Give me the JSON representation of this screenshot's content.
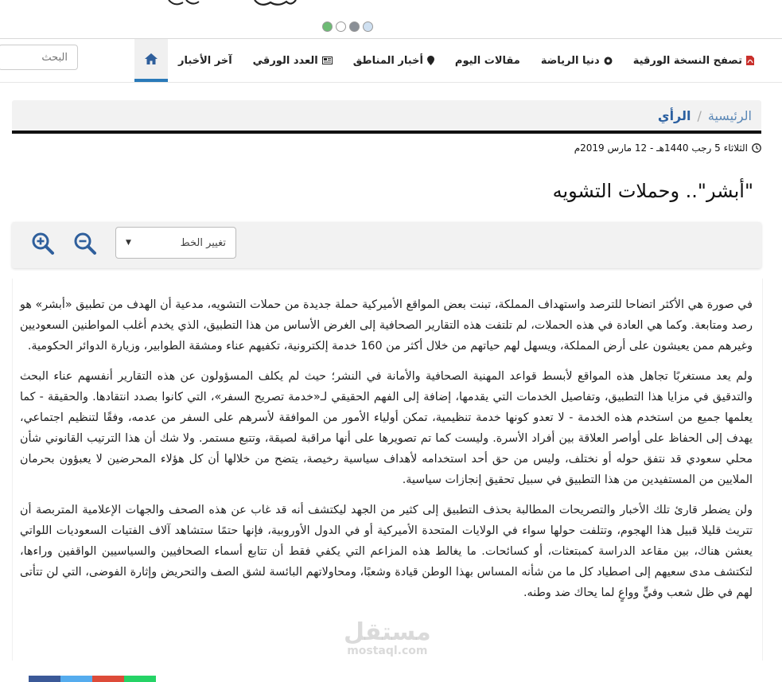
{
  "header": {
    "dots": [
      "#6dbb74",
      "#ffffff",
      "#8a8f96",
      "#cfe0f1"
    ]
  },
  "search": {
    "placeholder": "البحث"
  },
  "nav": {
    "items": [
      {
        "label": "",
        "icon": "home-icon"
      },
      {
        "label": "آخر الأخبار",
        "icon": ""
      },
      {
        "label": "العدد الورقي",
        "icon": "newspaper-icon"
      },
      {
        "label": "أخبار المناطق",
        "icon": "map-marker-icon"
      },
      {
        "label": "مقالات اليوم",
        "icon": ""
      },
      {
        "label": "دنيا الرياضة",
        "icon": "soccer-ball-icon"
      },
      {
        "label": "تصفح النسخة الورقية",
        "icon": "pdf-icon"
      }
    ]
  },
  "breadcrumb": {
    "home": "الرئيسية",
    "separator": "/",
    "current": "الرأي"
  },
  "article": {
    "date": "الثلاثاء 5 رجب 1440هـ - 12 مارس 2019م",
    "title": "\"أبشر\".. وحملات التشويه",
    "paragraphs": [
      "في صورة هي الأكثر اتضاحا للترصد واستهداف المملكة، تبنت بعض المواقع الأميركية حملة جديدة من حملات التشويه، مدعية أن الهدف من تطبيق «أبشر» هو رصد ومتابعة. وكما هي العادة في هذه الحملات، لم تلتفت هذه التقارير الصحافية إلى الغرض الأساس من هذا التطبيق، الذي يخدم أغلب المواطنين السعوديين وغيرهم ممن يعيشون على أرض المملكة، ويسهل لهم حياتهم من خلال أكثر من 160 خدمة إلكترونية، تكفيهم عناء ومشقة الطوابير، وزيارة الدوائر الحكومية.",
      "ولم يعد مستغربًا تجاهل هذه المواقع لأبسط قواعد المهنية الصحافية والأمانة في النشر؛ حيث لم يكلف المسؤولون عن هذه التقارير أنفسهم عناء البحث والتدقيق في مزايا هذا التطبيق، وتفاصيل الخدمات التي يقدمها، إضافة إلى الفهم الحقيقي لـ«خدمة تصريح السفر»، التي كانوا بصدد انتقادها. والحقيقة - كما يعلمها جميع من استخدم هذه الخدمة - لا تعدو كونها خدمة تنظيمية، تمكن أولياء الأمور من الموافقة لأسرهم على السفر من عدمه، وفقًا لتنظيم اجتماعي، يهدف إلى الحفاظ على أواصر العلاقة بين أفراد الأسرة. وليست كما تم تصويرها على أنها مراقبة لصيقة، وتتبع مستمر. ولا شك أن هذا الترتيب القانوني شأن محلي سعودي قد نتفق حوله أو نختلف، وليس من حق أحد استخدامه لأهداف سياسية رخيصة، يتضح من خلالها أن كل هؤلاء المحرضين لا يعبؤون بحرمان الملايين من المستفيدين من هذا التطبيق في سبيل تحقيق إنجازات سياسية.",
      "ولن يضطر قارئ تلك الأخبار والتصريحات المطالبة بحذف التطبيق إلى كثير من الجهد ليكتشف أنه قد غاب عن هذه الصحف والجهات الإعلامية المتربصة أن تتريث قليلا قبيل هذا الهجوم، وتتلفت حولها سواء في الولايات المتحدة الأميركية أو في الدول الأوروبية، فإنها حتمًا ستشاهد آلاف الفتيات السعوديات اللواتي يعشن هناك، بين مقاعد الدراسة كمبتعثات، أو كسائحات. ما يغالط هذه المزاعم التي يكفي فقط أن تتابع أسماء الصحافيين والسياسيين الواقفين وراءها، لتكتشف مدى سعيهم إلى اصطياد كل ما من شأنه المساس بهذا الوطن قيادة وشعبًا، ومحاولاتهم البائسة لشق الصف والتحريض وإثارة الفوضى، التي لن تتأتى لهم في ظل شعب وفيٍّ وواعٍ لما يحاك ضد وطنه."
    ]
  },
  "toolbar": {
    "font_select": "تغيير الخط"
  },
  "watermark": {
    "line1": "مستقل",
    "line2": "mostaql.com"
  },
  "share": {
    "colors": [
      "#3b5998",
      "#55acee",
      "#dd4b39",
      "#25d366"
    ]
  }
}
